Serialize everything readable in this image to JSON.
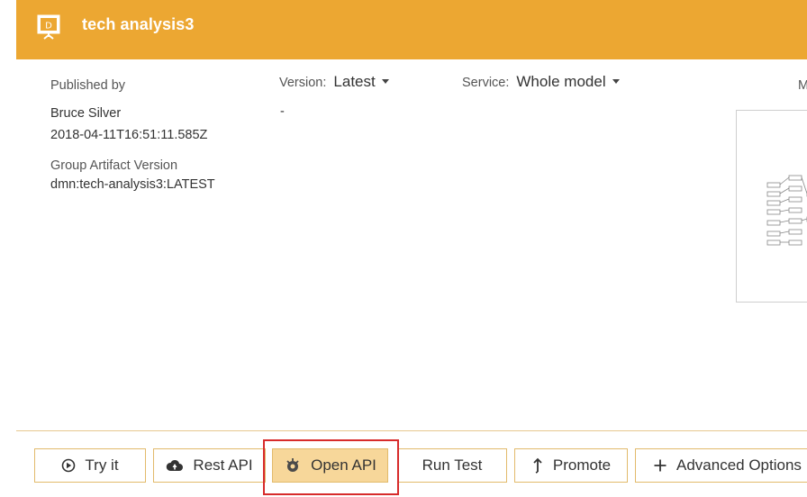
{
  "header": {
    "title": "tech analysis3",
    "icon": "decision-model-icon",
    "background": "#eca732"
  },
  "published": {
    "label": "Published by",
    "author": "Bruce Silver",
    "timestamp": "2018-04-11T16:51:11.585Z",
    "gav_label": "Group Artifact Version",
    "gav_value": "dmn:tech-analysis3:LATEST"
  },
  "version": {
    "label": "Version:",
    "value": "Latest",
    "description": "-"
  },
  "service": {
    "label": "Service:",
    "value": "Whole model"
  },
  "preview": {
    "label_partial": "M"
  },
  "actions": {
    "try_it": "Try it",
    "rest_api": "Rest API",
    "open_api": "Open API",
    "run_test": "Run Test",
    "promote": "Promote",
    "advanced_options": "Advanced Options"
  },
  "colors": {
    "accent": "#eca732",
    "button_border": "#e2ba6b",
    "active_button": "#f7d79a",
    "highlight": "#d72b2b"
  }
}
